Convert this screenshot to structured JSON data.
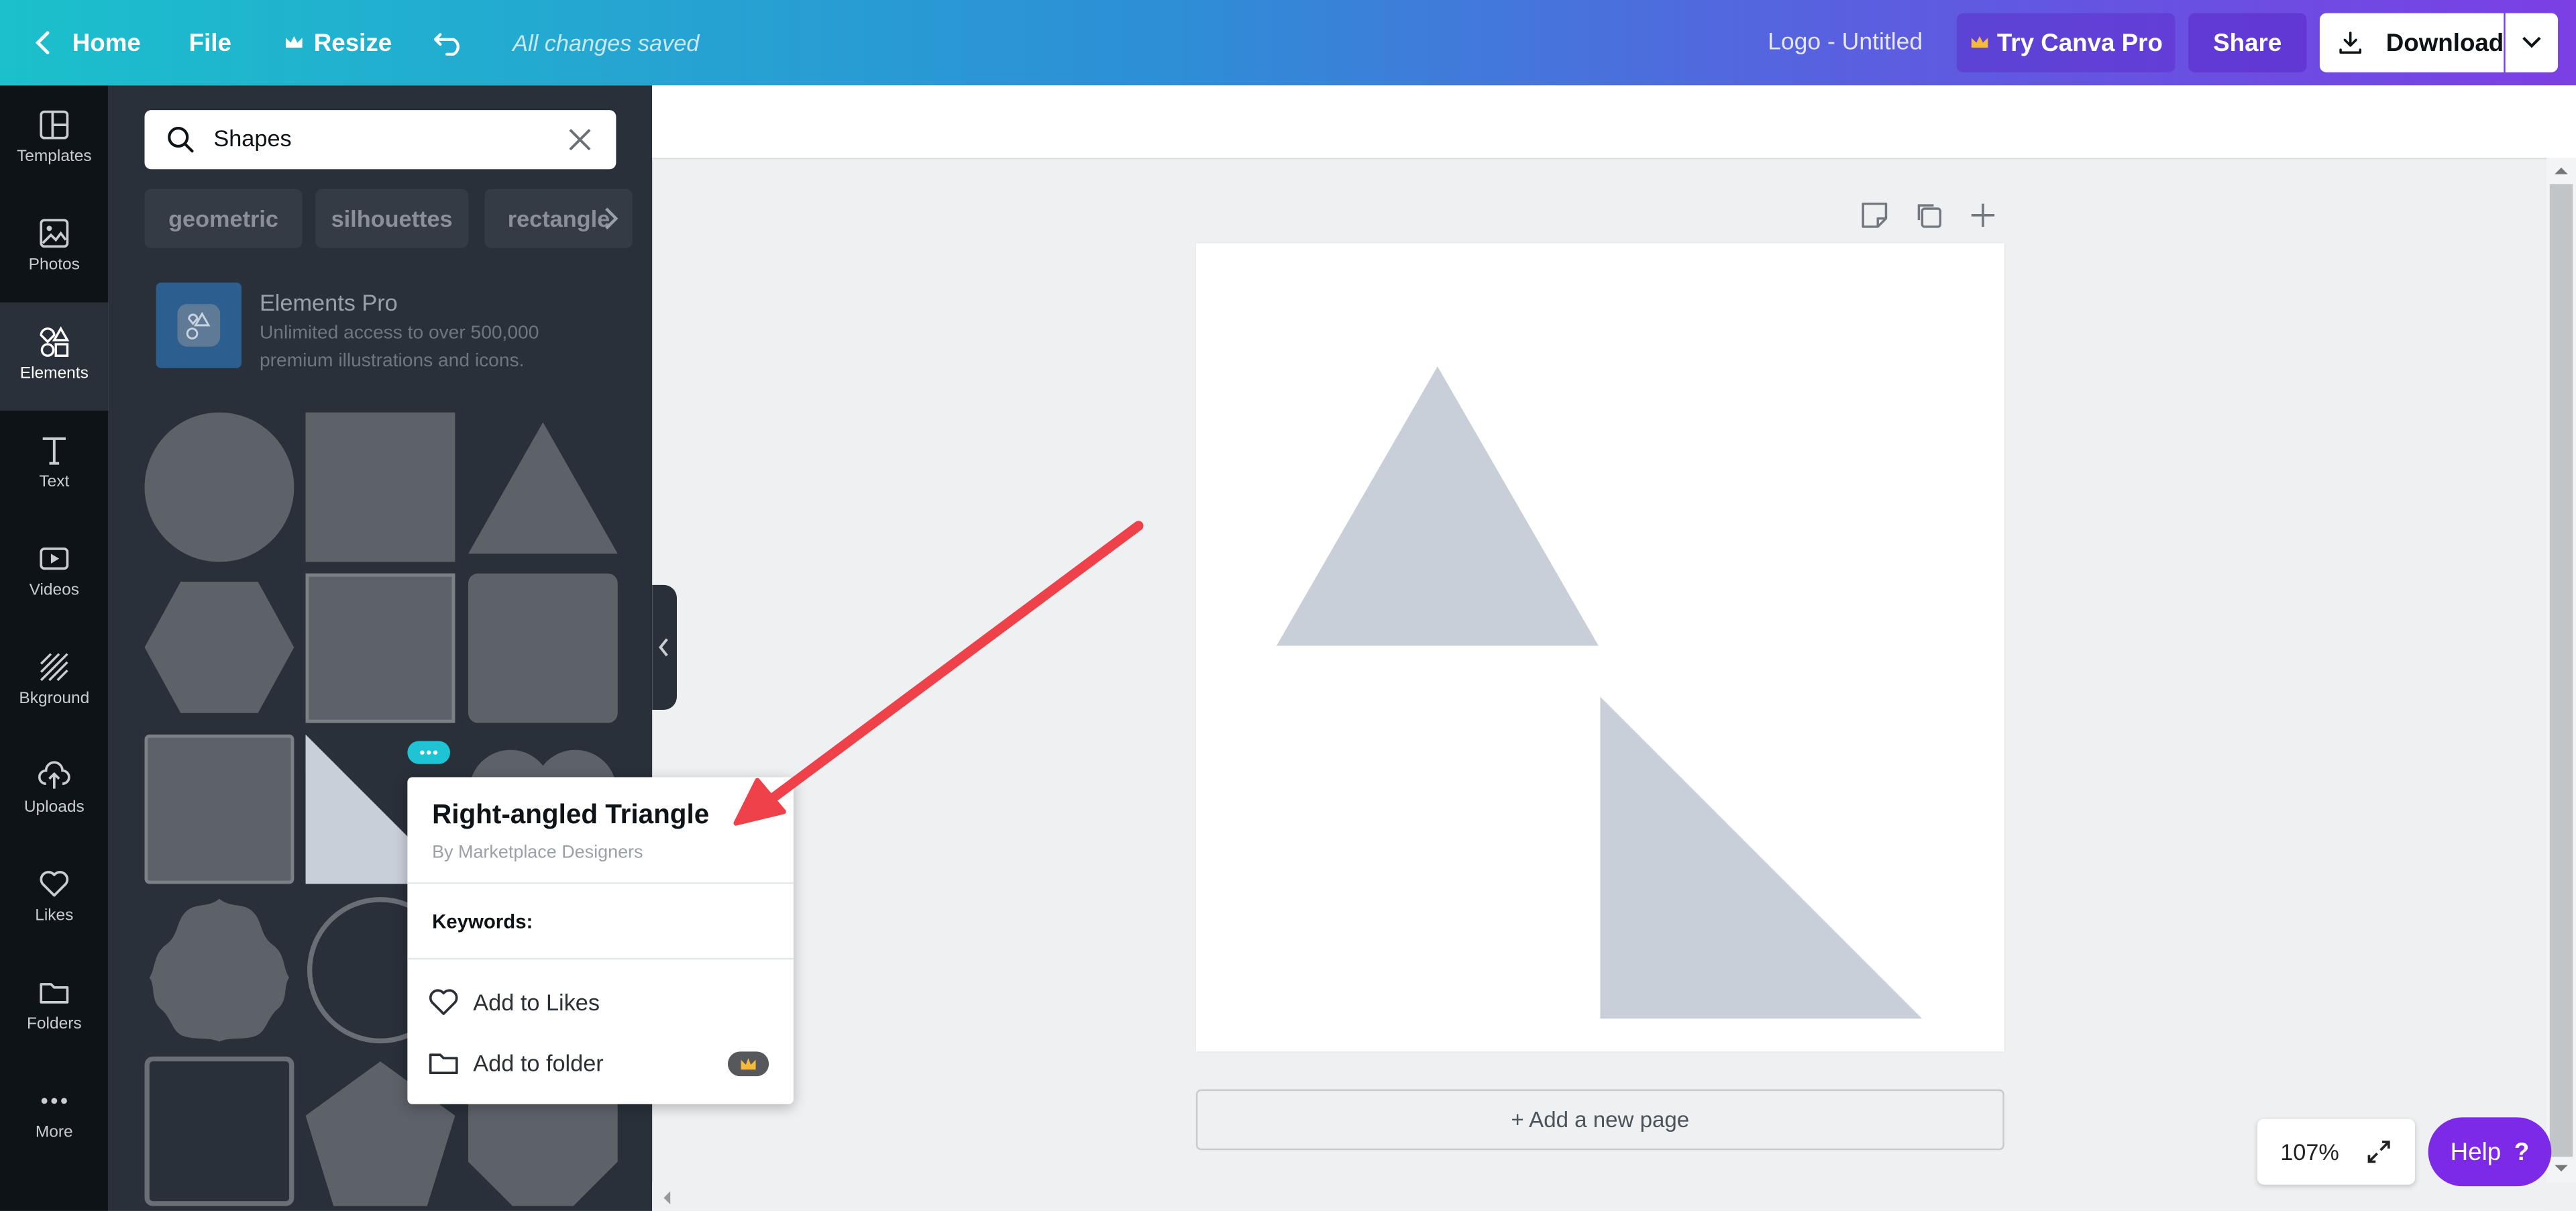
{
  "topbar": {
    "home_label": "Home",
    "file_label": "File",
    "resize_label": "Resize",
    "saved_status": "All changes saved",
    "doc_title": "Logo - Untitled",
    "try_pro_label": "Try Canva Pro",
    "share_label": "Share",
    "download_label": "Download"
  },
  "rail": {
    "items": [
      {
        "label": "Templates",
        "icon": "templates-icon"
      },
      {
        "label": "Photos",
        "icon": "photos-icon"
      },
      {
        "label": "Elements",
        "icon": "elements-icon",
        "active": true
      },
      {
        "label": "Text",
        "icon": "text-icon"
      },
      {
        "label": "Videos",
        "icon": "videos-icon"
      },
      {
        "label": "Bkground",
        "icon": "background-icon"
      },
      {
        "label": "Uploads",
        "icon": "uploads-icon"
      },
      {
        "label": "Likes",
        "icon": "heart-icon"
      },
      {
        "label": "Folders",
        "icon": "folder-icon"
      },
      {
        "label": "More",
        "icon": "more-icon"
      }
    ]
  },
  "panel": {
    "search_value": "Shapes",
    "chips": [
      "geometric",
      "silhouettes",
      "rectangle"
    ],
    "promo": {
      "title": "Elements Pro",
      "description": "Unlimited access to over 500,000 premium illustrations and icons."
    }
  },
  "popover": {
    "title": "Right-angled Triangle",
    "author": "By Marketplace Designers",
    "keywords_label": "Keywords:",
    "add_to_likes": "Add to Likes",
    "add_to_folder": "Add to folder"
  },
  "canvas": {
    "add_page_label": "+ Add a new page",
    "zoom_value": "107%",
    "help_label": "Help"
  },
  "colors": {
    "accent": "#7d2ae8",
    "shape_fill": "#c9cfd8",
    "annotation_arrow": "#ef4149"
  }
}
